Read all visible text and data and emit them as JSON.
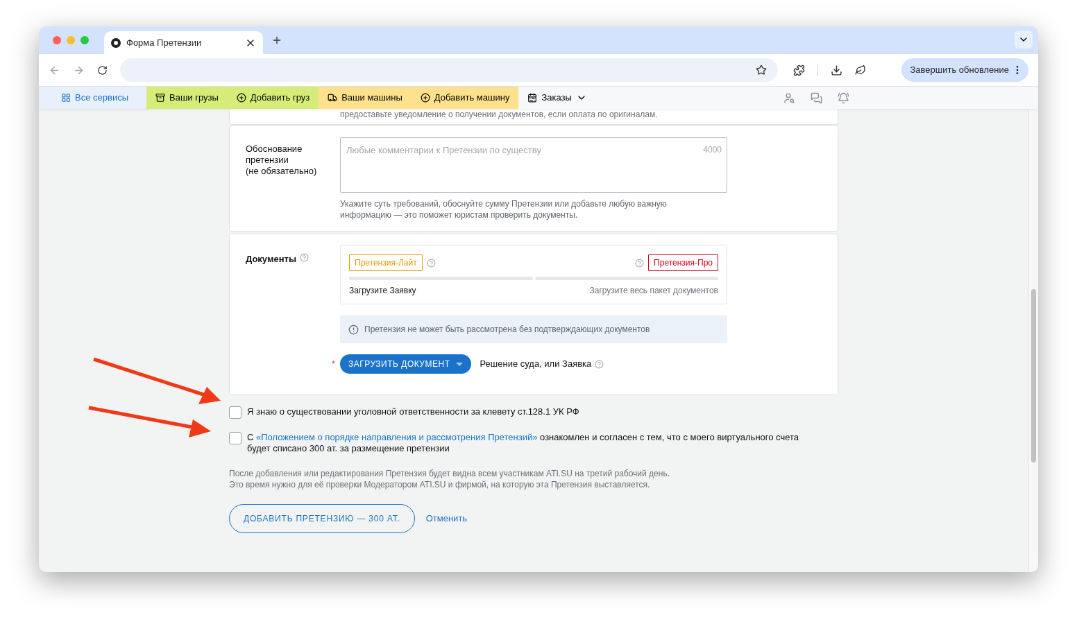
{
  "browser": {
    "tab_title": "Форма Претензии",
    "update_button": "Завершить обновление"
  },
  "nav": [
    {
      "label": "Все сервисы",
      "kind": "services"
    },
    {
      "label": "Ваши грузы",
      "kind": "cargo-list"
    },
    {
      "label": "Добавить груз",
      "kind": "cargo-add"
    },
    {
      "label": "Ваши машины",
      "kind": "truck-list"
    },
    {
      "label": "Добавить машину",
      "kind": "truck-add"
    },
    {
      "label": "Заказы",
      "kind": "orders"
    }
  ],
  "top_note": "предоставьте уведомление о получении документов, если оплата по оригиналам.",
  "justification": {
    "label": "Обоснование претензии (не обязательно)",
    "placeholder": "Любые комментарии к Претензии по существу",
    "counter": "4000",
    "hint": "Укажите суть требований, обоснуйте сумму Претензии или добавьте любую важную информацию — это поможет юристам проверить документы."
  },
  "documents": {
    "label": "Документы",
    "tiers": [
      {
        "label": "Претензия-Лайт",
        "color": "#e09b00",
        "caption": "Загрузите Заявку",
        "active": true
      },
      {
        "label": "Претензия-Про",
        "color": "#d0021b",
        "caption": "Загрузите весь пакет документов",
        "active": false
      }
    ],
    "alert": "Претензия не может быть рассмотрена без подтверждающих документов",
    "required_mark": "*",
    "upload_button": "ЗАГРУЗИТЬ ДОКУМЕНТ",
    "upload_hint": "Решение суда, или Заявка"
  },
  "agreements": [
    {
      "before": "Я знаю о существовании уголовной ответственности за клевету ст.128.1 УК РФ",
      "checked": false
    },
    {
      "before": "С",
      "link": "«Положением о порядке направления и рассмотрения Претензий»",
      "after": "ознакомлен и согласен с тем, что с моего виртуального счета будет списано 300 ат. за размещение претензии",
      "checked": false
    }
  ],
  "notice": [
    "После добавления или редактирования Претензия будет видна всем участникам ATI.SU на третий рабочий день.",
    "Это время нужно для её проверки Модератором ATI.SU и фирмой, на которую эта Претензия выставляется."
  ],
  "submit_button": "ДОБАВИТЬ ПРЕТЕНЗИЮ — 300 АТ.",
  "cancel_link": "Отменить"
}
